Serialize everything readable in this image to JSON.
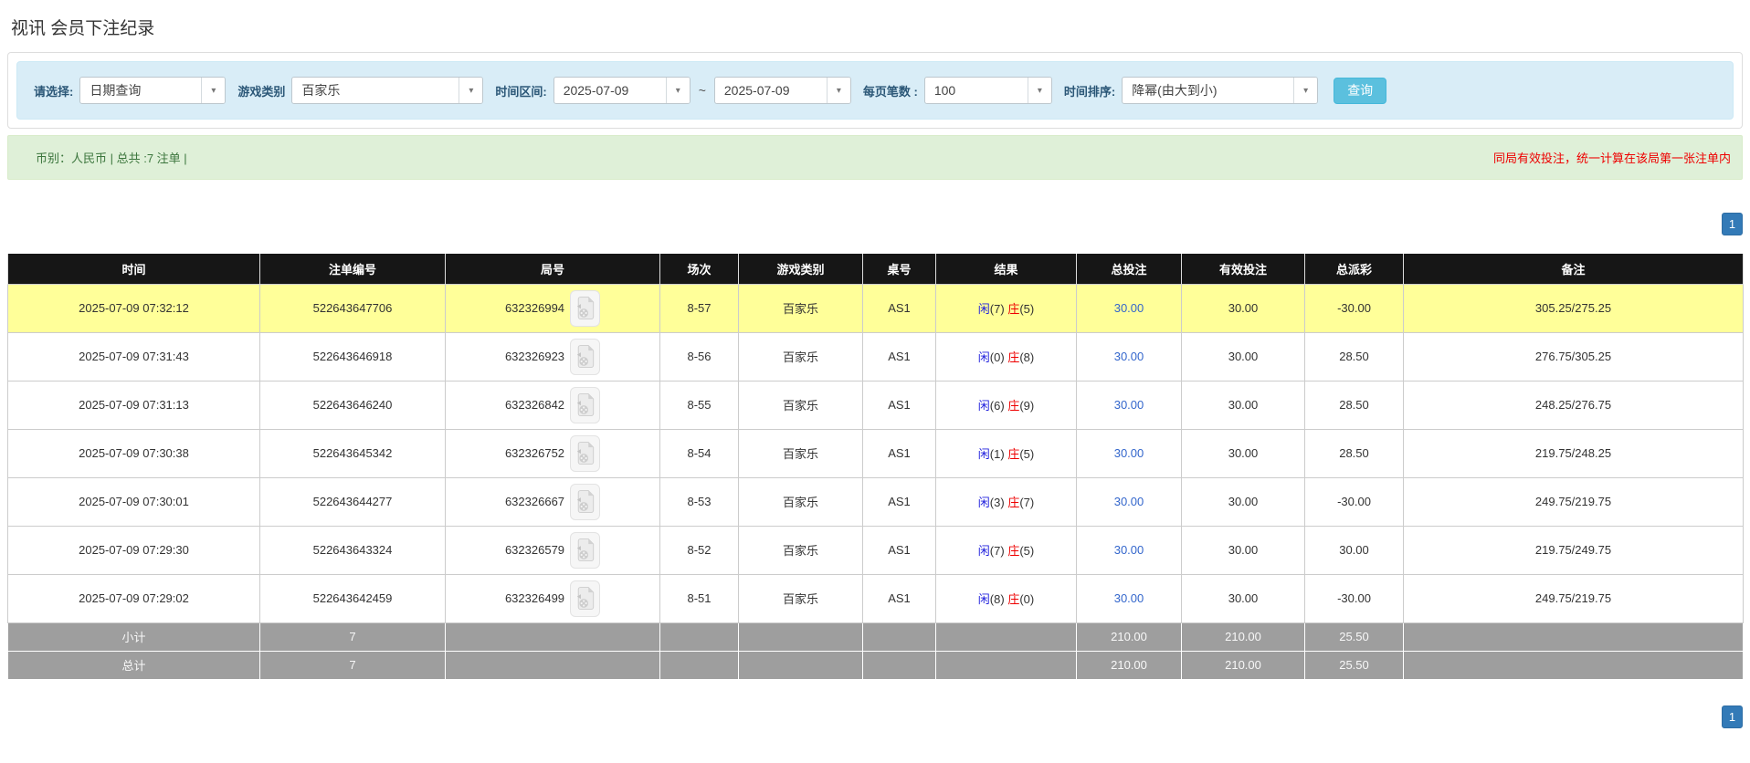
{
  "page_title": "视讯 会员下注纪录",
  "filters": {
    "select_label": "请选择:",
    "select_value": "日期查询",
    "game_type_label": "游戏类别",
    "game_type_value": "百家乐",
    "time_range_label": "时间区间:",
    "date_from": "2025-07-09",
    "date_separator": "~",
    "date_to": "2025-07-09",
    "page_size_label": "每页笔数 :",
    "page_size_value": "100",
    "sort_label": "时间排序:",
    "sort_value": "降幂(由大到小)",
    "search_button": "查询"
  },
  "summary_bar": {
    "left_text": "币别：人民币 | 总共 :7 注单 |",
    "right_notice": "同局有效投注，统一计算在该局第一张注单内"
  },
  "pagination": {
    "page": "1"
  },
  "colors": {
    "header_bg": "#161616",
    "highlight_row": "#ffff99",
    "footer_bg": "#9e9e9e",
    "player_blue": "#2222dd",
    "banker_red": "#ee0000",
    "amount_blue": "#3366cc",
    "negative_red": "#ee0000",
    "filter_bg": "#d9edf7",
    "summary_bg": "#dff0d8",
    "search_button": "#5bc0de",
    "pagination_blue": "#337ab7"
  },
  "table": {
    "columns": [
      "时间",
      "注单编号",
      "局号",
      "场次",
      "游戏类别",
      "桌号",
      "结果",
      "总投注",
      "有效投注",
      "总派彩",
      "备注"
    ],
    "rows": [
      {
        "time": "2025-07-09 07:32:12",
        "bet_id": "522643647706",
        "round_id": "632326994",
        "session": "8-57",
        "game": "百家乐",
        "table_no": "AS1",
        "result_player": "闲",
        "result_player_n": "(7)",
        "result_banker": "庄",
        "result_banker_n": "(5)",
        "total_bet": "30.00",
        "valid_bet": "30.00",
        "payout": "-30.00",
        "remark": "305.25/275.25",
        "highlighted": true
      },
      {
        "time": "2025-07-09 07:31:43",
        "bet_id": "522643646918",
        "round_id": "632326923",
        "session": "8-56",
        "game": "百家乐",
        "table_no": "AS1",
        "result_player": "闲",
        "result_player_n": "(0)",
        "result_banker": "庄",
        "result_banker_n": "(8)",
        "total_bet": "30.00",
        "valid_bet": "30.00",
        "payout": "28.50",
        "remark": "276.75/305.25",
        "highlighted": false
      },
      {
        "time": "2025-07-09 07:31:13",
        "bet_id": "522643646240",
        "round_id": "632326842",
        "session": "8-55",
        "game": "百家乐",
        "table_no": "AS1",
        "result_player": "闲",
        "result_player_n": "(6)",
        "result_banker": "庄",
        "result_banker_n": "(9)",
        "total_bet": "30.00",
        "valid_bet": "30.00",
        "payout": "28.50",
        "remark": "248.25/276.75",
        "highlighted": false
      },
      {
        "time": "2025-07-09 07:30:38",
        "bet_id": "522643645342",
        "round_id": "632326752",
        "session": "8-54",
        "game": "百家乐",
        "table_no": "AS1",
        "result_player": "闲",
        "result_player_n": "(1)",
        "result_banker": "庄",
        "result_banker_n": "(5)",
        "total_bet": "30.00",
        "valid_bet": "30.00",
        "payout": "28.50",
        "remark": "219.75/248.25",
        "highlighted": false
      },
      {
        "time": "2025-07-09 07:30:01",
        "bet_id": "522643644277",
        "round_id": "632326667",
        "session": "8-53",
        "game": "百家乐",
        "table_no": "AS1",
        "result_player": "闲",
        "result_player_n": "(3)",
        "result_banker": "庄",
        "result_banker_n": "(7)",
        "total_bet": "30.00",
        "valid_bet": "30.00",
        "payout": "-30.00",
        "remark": "249.75/219.75",
        "highlighted": false
      },
      {
        "time": "2025-07-09 07:29:30",
        "bet_id": "522643643324",
        "round_id": "632326579",
        "session": "8-52",
        "game": "百家乐",
        "table_no": "AS1",
        "result_player": "闲",
        "result_player_n": "(7)",
        "result_banker": "庄",
        "result_banker_n": "(5)",
        "total_bet": "30.00",
        "valid_bet": "30.00",
        "payout": "30.00",
        "remark": "219.75/249.75",
        "highlighted": false
      },
      {
        "time": "2025-07-09 07:29:02",
        "bet_id": "522643642459",
        "round_id": "632326499",
        "session": "8-51",
        "game": "百家乐",
        "table_no": "AS1",
        "result_player": "闲",
        "result_player_n": "(8)",
        "result_banker": "庄",
        "result_banker_n": "(0)",
        "total_bet": "30.00",
        "valid_bet": "30.00",
        "payout": "-30.00",
        "remark": "249.75/219.75",
        "highlighted": false
      }
    ],
    "subtotal": {
      "label": "小计",
      "count": "7",
      "total_bet": "210.00",
      "valid_bet": "210.00",
      "payout": "25.50"
    },
    "total": {
      "label": "总计",
      "count": "7",
      "total_bet": "210.00",
      "valid_bet": "210.00",
      "payout": "25.50"
    }
  }
}
